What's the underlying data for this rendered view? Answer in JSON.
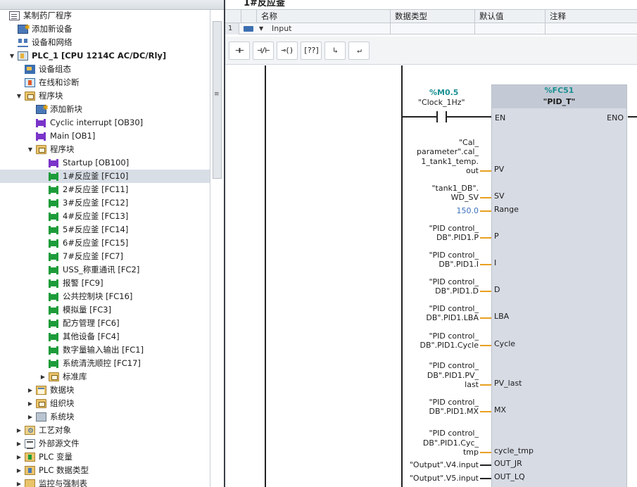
{
  "tree": {
    "items": [
      {
        "label": "某制药厂程序",
        "icon": "document-icon",
        "arrow": "",
        "indent": 0
      },
      {
        "label": "添加新设备",
        "icon": "add-device-icon",
        "arrow": "",
        "indent": 1
      },
      {
        "label": "设备和网络",
        "icon": "network-icon",
        "arrow": "",
        "indent": 1
      },
      {
        "label": "PLC_1 [CPU 1214C AC/DC/Rly]",
        "icon": "cpu-icon",
        "arrow": "▼",
        "indent": 1,
        "bold": true
      },
      {
        "label": "设备组态",
        "icon": "device-config-icon",
        "arrow": "",
        "indent": 2
      },
      {
        "label": "在线和诊断",
        "icon": "online-diagnostics-icon",
        "arrow": "",
        "indent": 2
      },
      {
        "label": "程序块",
        "icon": "folder-icon",
        "arrow": "▼",
        "indent": 2
      },
      {
        "label": "添加新块",
        "icon": "add-block-icon",
        "arrow": "",
        "indent": 3
      },
      {
        "label": "Cyclic interrupt [OB30]",
        "icon": "ob-block-icon",
        "arrow": "",
        "indent": 3
      },
      {
        "label": "Main [OB1]",
        "icon": "ob-block-icon",
        "arrow": "",
        "indent": 3
      },
      {
        "label": "程序块",
        "icon": "folder-icon",
        "arrow": "▼",
        "indent": 3
      },
      {
        "label": "Startup [OB100]",
        "icon": "ob-block-icon",
        "arrow": "",
        "indent": 4
      },
      {
        "label": "1#反应釜 [FC10]",
        "icon": "fc-block-icon",
        "arrow": "",
        "indent": 4,
        "selected": true
      },
      {
        "label": "2#反应釜 [FC11]",
        "icon": "fc-block-icon",
        "arrow": "",
        "indent": 4
      },
      {
        "label": "3#反应釜 [FC12]",
        "icon": "fc-block-icon",
        "arrow": "",
        "indent": 4
      },
      {
        "label": "4#反应釜 [FC13]",
        "icon": "fc-block-icon",
        "arrow": "",
        "indent": 4
      },
      {
        "label": "5#反应釜 [FC14]",
        "icon": "fc-block-icon",
        "arrow": "",
        "indent": 4
      },
      {
        "label": "6#反应釜 [FC15]",
        "icon": "fc-block-icon",
        "arrow": "",
        "indent": 4
      },
      {
        "label": "7#反应釜 [FC7]",
        "icon": "fc-block-icon",
        "arrow": "",
        "indent": 4
      },
      {
        "label": "USS_称重通讯 [FC2]",
        "icon": "fc-block-icon",
        "arrow": "",
        "indent": 4
      },
      {
        "label": "报警 [FC9]",
        "icon": "fc-block-icon",
        "arrow": "",
        "indent": 4
      },
      {
        "label": "公共控制块 [FC16]",
        "icon": "fc-block-icon",
        "arrow": "",
        "indent": 4
      },
      {
        "label": "模拟量 [FC3]",
        "icon": "fc-block-icon",
        "arrow": "",
        "indent": 4
      },
      {
        "label": "配方管理 [FC6]",
        "icon": "fc-block-icon",
        "arrow": "",
        "indent": 4
      },
      {
        "label": "其他设备 [FC4]",
        "icon": "fc-block-icon",
        "arrow": "",
        "indent": 4
      },
      {
        "label": "数字量输入输出 [FC1]",
        "icon": "fc-block-icon",
        "arrow": "",
        "indent": 4
      },
      {
        "label": "系统清洗顺控 [FC17]",
        "icon": "fc-block-icon",
        "arrow": "",
        "indent": 4
      },
      {
        "label": "标准库",
        "icon": "folder-icon",
        "arrow": "▶",
        "indent": 4
      },
      {
        "label": "数据块",
        "icon": "data-block-folder-icon",
        "arrow": "▶",
        "indent": 3
      },
      {
        "label": "组织块",
        "icon": "folder-icon",
        "arrow": "▶",
        "indent": 3
      },
      {
        "label": "系统块",
        "icon": "system-block-icon",
        "arrow": "▶",
        "indent": 3
      },
      {
        "label": "工艺对象",
        "icon": "technology-object-icon",
        "arrow": "▶",
        "indent": 2
      },
      {
        "label": "外部源文件",
        "icon": "external-source-icon",
        "arrow": "▶",
        "indent": 2
      },
      {
        "label": "PLC 变量",
        "icon": "plc-tags-icon",
        "arrow": "▶",
        "indent": 2
      },
      {
        "label": "PLC 数据类型",
        "icon": "plc-data-types-icon",
        "arrow": "▶",
        "indent": 2
      },
      {
        "label": "监控与强制表",
        "icon": "watch-table-icon",
        "arrow": "▶",
        "indent": 2
      }
    ]
  },
  "editor": {
    "block_title": "1#反应釜",
    "interface": {
      "headers": [
        "名称",
        "数据类型",
        "默认值",
        "注释"
      ],
      "row": {
        "number": "1",
        "name": "Input",
        "expanded": true
      }
    },
    "toolbar": [
      {
        "label": "⊣⊢",
        "name": "no-contact-button"
      },
      {
        "label": "⊣/⊢",
        "name": "nc-contact-button"
      },
      {
        "label": "⊸()",
        "name": "coil-button"
      },
      {
        "label": "[??]",
        "name": "empty-box-button"
      },
      {
        "label": "↳",
        "name": "open-branch-button"
      },
      {
        "label": "↵",
        "name": "close-branch-button"
      }
    ],
    "network": {
      "contact": {
        "address": "%M0.5",
        "name": "\"Clock_1Hz\""
      },
      "block": {
        "address": "%FC51",
        "name": "\"PID_T\"",
        "en": "EN",
        "eno": "ENO",
        "inputs": [
          {
            "pin": "PV",
            "operand": [
              "\"Cal_",
              "parameter\".cal_",
              "1_tank1_temp.",
              "out"
            ]
          },
          {
            "pin": "SV",
            "operand": [
              "\"tank1_DB\".",
              "WD_SV"
            ]
          },
          {
            "pin": "Range",
            "operand": [
              "150.0"
            ],
            "constant": true
          },
          {
            "pin": "P",
            "operand": [
              "\"PID control_",
              "DB\".PID1.P"
            ]
          },
          {
            "pin": "I",
            "operand": [
              "\"PID control_",
              "DB\".PID1.I"
            ]
          },
          {
            "pin": "D",
            "operand": [
              "\"PID control_",
              "DB\".PID1.D"
            ]
          },
          {
            "pin": "LBA",
            "operand": [
              "\"PID control_",
              "DB\".PID1.LBA"
            ]
          },
          {
            "pin": "Cycle",
            "operand": [
              "\"PID control_",
              "DB\".PID1.Cycle"
            ]
          },
          {
            "pin": "PV_last",
            "operand": [
              "\"PID control_",
              "DB\".PID1.PV_",
              "last"
            ]
          },
          {
            "pin": "MX",
            "operand": [
              "\"PID control_",
              "DB\".PID1.MX"
            ]
          },
          {
            "pin": "cycle_tmp",
            "operand": [
              "\"PID control_",
              "DB\".PID1.Cyc_",
              "tmp"
            ]
          },
          {
            "pin": "OUT_JR",
            "operand": [
              "\"Output\".V4.input"
            ],
            "output": true
          },
          {
            "pin": "OUT_LQ",
            "operand": [
              "\"Output\".V5.input"
            ],
            "output": true
          }
        ]
      }
    }
  }
}
